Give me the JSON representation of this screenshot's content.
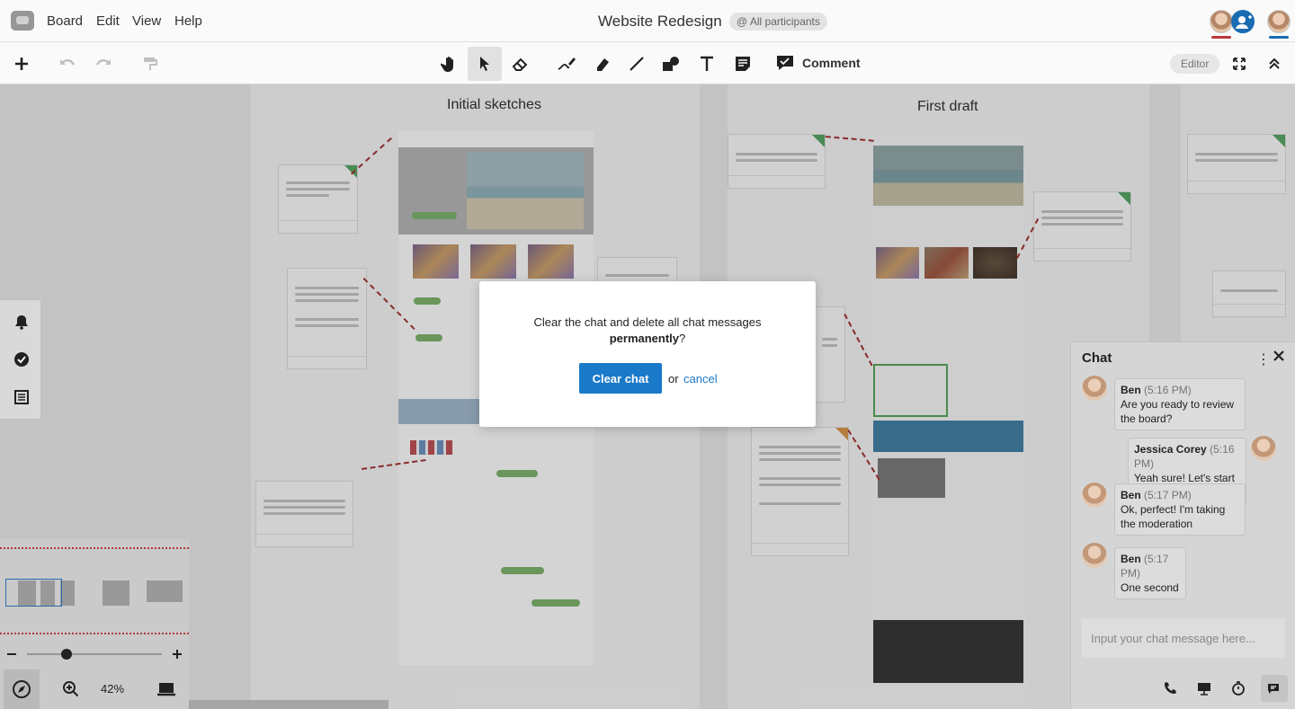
{
  "menubar": {
    "menus": [
      "Board",
      "Edit",
      "View",
      "Help"
    ],
    "title": "Website Redesign",
    "participants_label": "All participants"
  },
  "toolbar": {
    "comment_label": "Comment",
    "mode_label": "Editor"
  },
  "canvas": {
    "frames": [
      {
        "title": "Initial sketches"
      },
      {
        "title": "First draft"
      }
    ]
  },
  "minimap": {
    "zoom_level": "42%"
  },
  "chat": {
    "title": "Chat",
    "messages": [
      {
        "author": "Ben",
        "time": "(5:16 PM)",
        "text": "Are you ready to review the board?"
      },
      {
        "author": "Jessica Corey",
        "time": "(5:16 PM)",
        "text": "Yeah sure! Let's start :-)"
      },
      {
        "author": "Ben",
        "time": "(5:17 PM)",
        "text": "Ok, perfect! I'm taking the moderation"
      },
      {
        "author": "Ben",
        "time": "(5:17 PM)",
        "text": "One second"
      }
    ],
    "input_placeholder": "Input your chat message here..."
  },
  "dialog": {
    "message_prefix": "Clear the chat and delete all chat messages ",
    "message_emphasis": "permanently",
    "message_suffix": "?",
    "confirm_label": "Clear chat",
    "or_label": "or",
    "cancel_label": "cancel"
  },
  "colors": {
    "accent": "#1a79c8",
    "avatar_bar_red": "#c23a3a",
    "avatar_bar_blue": "#1a6fb5",
    "comment_pin_green": "#4b8e56",
    "connector_red": "#8c2b2b"
  }
}
